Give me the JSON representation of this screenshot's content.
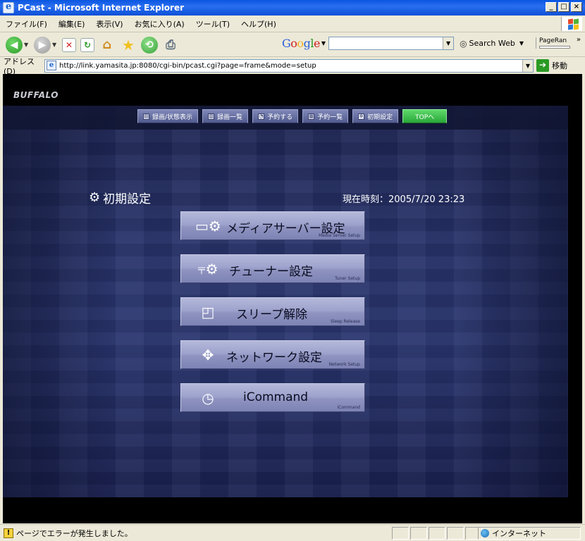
{
  "window": {
    "title": "PCast - Microsoft Internet Explorer",
    "buttons": [
      "_",
      "□",
      "×"
    ]
  },
  "menubar": {
    "items": [
      "ファイル(F)",
      "編集(E)",
      "表示(V)",
      "お気に入り(A)",
      "ツール(T)",
      "ヘルプ(H)"
    ]
  },
  "toolbar": {
    "google_letters": [
      "G",
      "o",
      "o",
      "g",
      "l",
      "e"
    ],
    "search_web_label": "Search Web",
    "pagerank_label": "PageRan",
    "overflow": "»"
  },
  "address": {
    "label": "アドレス(D)",
    "url": "http://link.yamasita.jp:8080/cgi-bin/pcast.cgi?page=frame&mode=setup",
    "go_label": "移動"
  },
  "page": {
    "brand": "BUFFALO",
    "nav": [
      {
        "label": "録画/状態表示"
      },
      {
        "label": "録画一覧"
      },
      {
        "label": "予約する"
      },
      {
        "label": "予約一覧"
      },
      {
        "label": "初期設定"
      },
      {
        "label": "TOPへ"
      }
    ],
    "title": "初期設定",
    "clock_label": "現在時刻：",
    "clock_value": "2005/7/20 23:23",
    "menu": [
      {
        "label": "メディアサーバー設定",
        "sub": "Media Server Setup"
      },
      {
        "label": "チューナー設定",
        "sub": "Tuner Setup"
      },
      {
        "label": "スリープ解除",
        "sub": "Sleep Release"
      },
      {
        "label": "ネットワーク設定",
        "sub": "Network Setup"
      },
      {
        "label": "iCommand",
        "sub": "iCommand"
      }
    ]
  },
  "status": {
    "text": "ページでエラーが発生しました。",
    "zone": "インターネット"
  },
  "colors": {
    "title_bar": "#0a56e0",
    "nav_top_button": "#3ab84a",
    "content_bg": "#28336a"
  }
}
